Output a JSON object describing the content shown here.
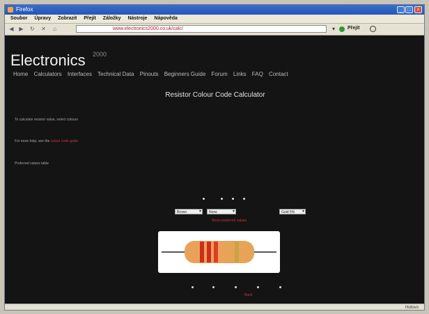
{
  "window": {
    "title": "Firefox",
    "minimize": "_",
    "maximize": "□",
    "close": "×"
  },
  "menu": [
    "Soubor",
    "Úpravy",
    "Zobrazit",
    "Přejít",
    "Záložky",
    "Nástroje",
    "Nápověda"
  ],
  "navbar": {
    "back": "◀",
    "forward": "▶",
    "reload": "↻",
    "stop": "✕",
    "home": "⌂",
    "url": "www.electronics2000.co.uk/calc/",
    "go_label": "Přejít"
  },
  "site": {
    "title": "Electronics",
    "year": "2000",
    "nav": [
      "Home",
      "Calculators",
      "Interfaces",
      "Technical Data",
      "Pinouts",
      "Beginners Guide",
      "Forum",
      "Links",
      "FAQ",
      "Contact"
    ]
  },
  "page": {
    "heading": "Resistor Colour Code Calculator",
    "intro": [
      {
        "text": "To calculate resistor value, select colours",
        "link": ""
      },
      {
        "text": "For more help, see the ",
        "link": "colour code guide"
      },
      {
        "text": "Preferred values table",
        "link": ""
      }
    ]
  },
  "calculator": {
    "band_select_1": "Brown",
    "band_select_2": "None",
    "tolerance_select": "Gold 5%",
    "result_link": "Show preferred values",
    "bottom_link": "Back"
  },
  "colors": {
    "body_band": "#e7a357",
    "band_1": "#d32a1e",
    "band_2": "#d32a1e",
    "band_3": "#e23b24",
    "band_4": "#c9a446",
    "lead": "#585858",
    "link": "#c23a3a"
  },
  "status": {
    "text": "Hotovo"
  }
}
